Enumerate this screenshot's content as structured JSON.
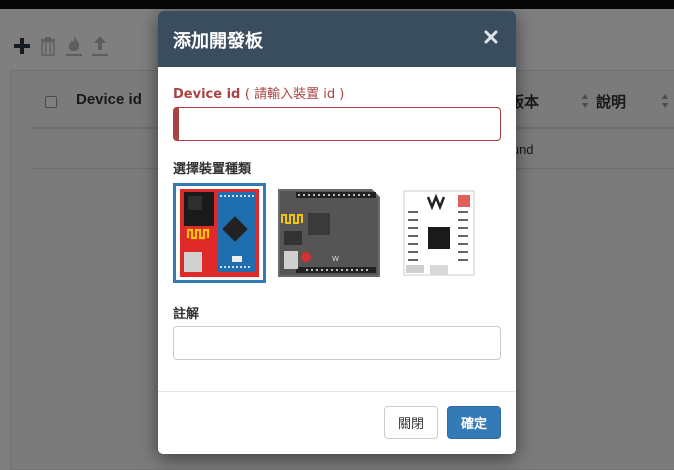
{
  "background": {
    "toolbar": {
      "icons": [
        "plus-icon",
        "trash-icon",
        "flame-icon",
        "upload-icon"
      ]
    },
    "table": {
      "columns": [
        "Device id",
        "版本",
        "說明"
      ],
      "empty_text": "found"
    }
  },
  "modal": {
    "title": "添加開發板",
    "close_glyph": "×",
    "device_id_label": "Device id",
    "device_id_hint": "( 請輸入裝置 id )",
    "device_id_value": "",
    "device_type_label": "選擇裝置種類",
    "boards": [
      {
        "name": "board-nano-red",
        "selected": true
      },
      {
        "name": "board-uno-gray",
        "selected": false
      },
      {
        "name": "board-mini-white",
        "selected": false
      }
    ],
    "note_label": "註解",
    "note_value": "",
    "buttons": {
      "close_label": "關閉",
      "ok_label": "確定"
    }
  },
  "colors": {
    "header_bg": "#3a4d5e",
    "error": "#a94442",
    "primary": "#337ab7"
  }
}
